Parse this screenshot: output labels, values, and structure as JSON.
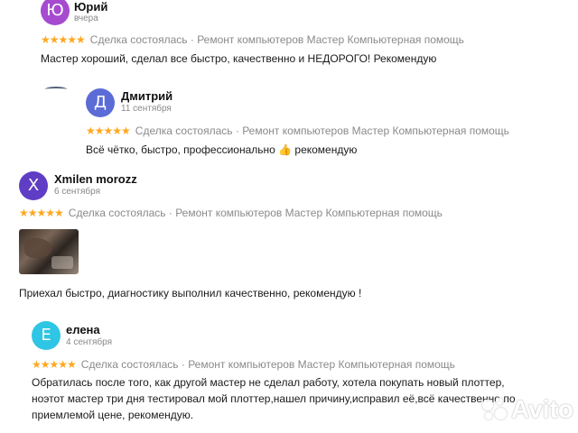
{
  "reviews": [
    {
      "initial": "Ю",
      "avatar_color": "#a64bd0",
      "name": "Юрий",
      "date": "вчера",
      "rating": "★★★★★",
      "deal": "Сделка состоялась · Ремонт компьютеров Мастер Компьютерная помощь",
      "text": "Мастер хороший, сделал все быстро, качественно и НЕДОРОГО! Рекомендую"
    },
    {
      "initial": "Д",
      "avatar_color": "#5b6cd6",
      "name": "Дмитрий",
      "date": "11 сентября",
      "rating": "★★★★★",
      "deal": "Сделка состоялась · Ремонт компьютеров Мастер Компьютерная помощь",
      "text": "Всё чётко, быстро, профессионально 👍 рекомендую"
    },
    {
      "initial": "X",
      "avatar_color": "#5f3dc4",
      "name": "Xmilen morozz",
      "date": "6 сентября",
      "rating": "★★★★★",
      "deal": "Сделка состоялась · Ремонт компьютеров Мастер Компьютерная помощь",
      "text": "Приехал быстро, диагностику выполнил качественно, рекомендую !"
    },
    {
      "initial": "Е",
      "avatar_color": "#2ec6e4",
      "name": "елена",
      "date": "4 сентября",
      "rating": "★★★★★",
      "deal": "Сделка состоялась · Ремонт компьютеров Мастер Компьютерная помощь",
      "text_lines": [
        "Обратилась после того, как другой мастер не сделал работу, хотела покупать новый плоттер,",
        "ноэтот мастер три дня тестировал мой плоттер,нашел причину,исправил её,всё качественно,по",
        "приемлемой цене, рекомендую."
      ]
    }
  ],
  "watermark": {
    "text": "Avito"
  }
}
